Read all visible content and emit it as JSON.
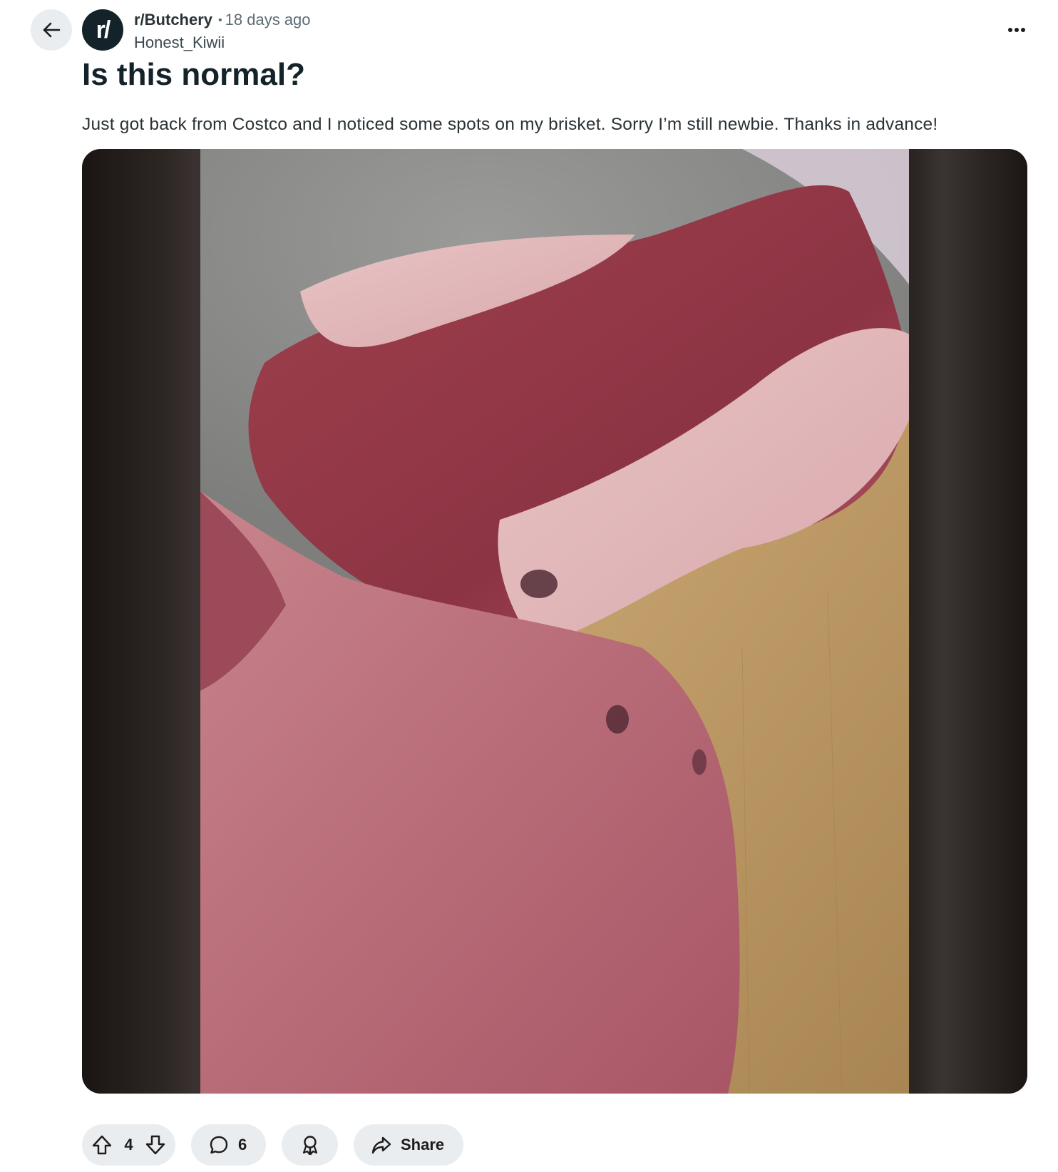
{
  "header": {
    "subreddit": "r/Butchery",
    "separator": "•",
    "age": "18 days ago",
    "author": "Honest_Kiwii",
    "avatar_text": "r/"
  },
  "post": {
    "title": "Is this normal?",
    "body": "Just got back from Costco and I noticed some spots on my brisket. Sorry I’m still newbie. Thanks in advance!"
  },
  "actions": {
    "votes": "4",
    "comments": "6",
    "share_label": "Share"
  },
  "icons": {
    "back": "arrow-left-icon",
    "more": "more-horizontal-icon",
    "upvote": "upvote-arrow-icon",
    "downvote": "downvote-arrow-icon",
    "comment": "comment-bubble-icon",
    "award": "award-ribbon-icon",
    "share": "share-arrow-icon"
  },
  "colors": {
    "pill_bg": "#eaedef",
    "avatar_bg": "#14232a",
    "meta_gray": "#5c6c74"
  }
}
